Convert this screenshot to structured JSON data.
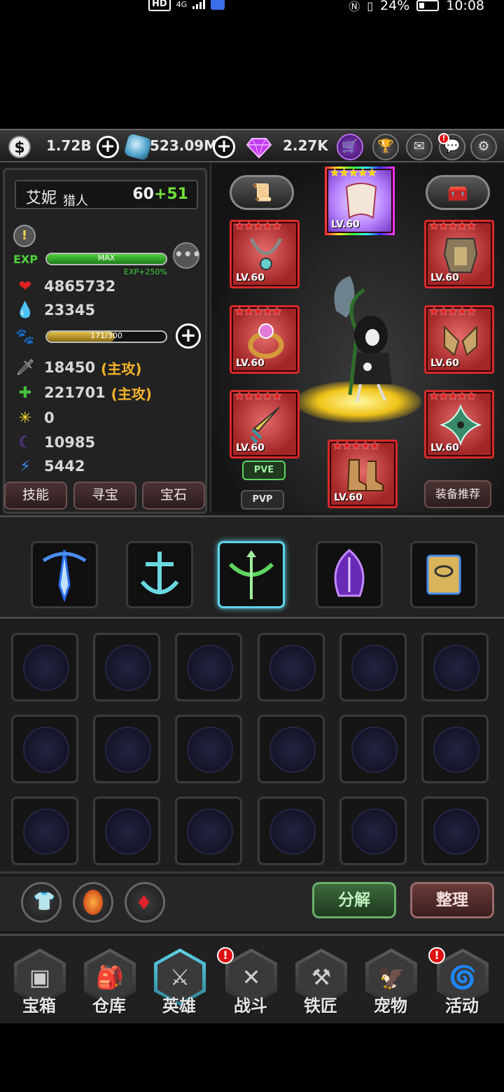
{
  "status_bar": {
    "hd": "HD",
    "signal": "4G",
    "battery": "24%",
    "time": "10:08"
  },
  "currency": {
    "gold": "1.72B",
    "crystal": "523.09M",
    "gems": "2.27K"
  },
  "top_icons": [
    "shop-icon",
    "trophy-icon",
    "mail-icon",
    "chat-icon",
    "gear-icon"
  ],
  "hero": {
    "name": "艾妮",
    "class": "猎人",
    "level": "60",
    "level_bonus": "+51",
    "exp_label": "EXP",
    "exp_bar": "MAX",
    "exp_bonus": "EXP+250%",
    "pet_bar": "171/300",
    "pet_fraction": 0.57
  },
  "stats": {
    "hp": "4865732",
    "mp": "23345",
    "atk": "18450",
    "atk_tag": "(主攻)",
    "atk2": "221701",
    "atk2_tag": "(主攻)",
    "crit": "0",
    "dark": "10985",
    "speed": "5442"
  },
  "left_tabs": [
    "技能",
    "寻宝",
    "宝石"
  ],
  "equipment": {
    "slots": [
      {
        "name": "necklace",
        "level": "LV.60"
      },
      {
        "name": "ring",
        "level": "LV.60"
      },
      {
        "name": "weapon",
        "level": "LV.60"
      },
      {
        "name": "armor",
        "level": "LV.60"
      },
      {
        "name": "gloves",
        "level": "LV.60"
      },
      {
        "name": "shuriken",
        "level": "LV.60"
      },
      {
        "name": "boots",
        "level": "LV.60"
      },
      {
        "name": "cape",
        "level": "LV.60"
      }
    ],
    "stars": "★★★★★",
    "pve": "PVE",
    "pvp": "PVP",
    "recommend": "装备推荐"
  },
  "inventory_actions": {
    "decompose": "分解",
    "sort": "整理"
  },
  "nav": [
    {
      "label": "宝箱",
      "icon": "chest-icon"
    },
    {
      "label": "仓库",
      "icon": "backpack-icon"
    },
    {
      "label": "英雄",
      "icon": "sword-icon"
    },
    {
      "label": "战斗",
      "icon": "battle-icon"
    },
    {
      "label": "铁匠",
      "icon": "anvil-icon"
    },
    {
      "label": "宠物",
      "icon": "eagle-icon"
    },
    {
      "label": "活动",
      "icon": "swirl-icon"
    }
  ],
  "colors": {
    "accent": "#5fd4e8",
    "exp_green": "#2fa52a",
    "pet_gold": "#c9a227",
    "slot_red": "#d72a2a",
    "level_green": "#6fe03a",
    "tag_orange": "#f5b52c"
  }
}
